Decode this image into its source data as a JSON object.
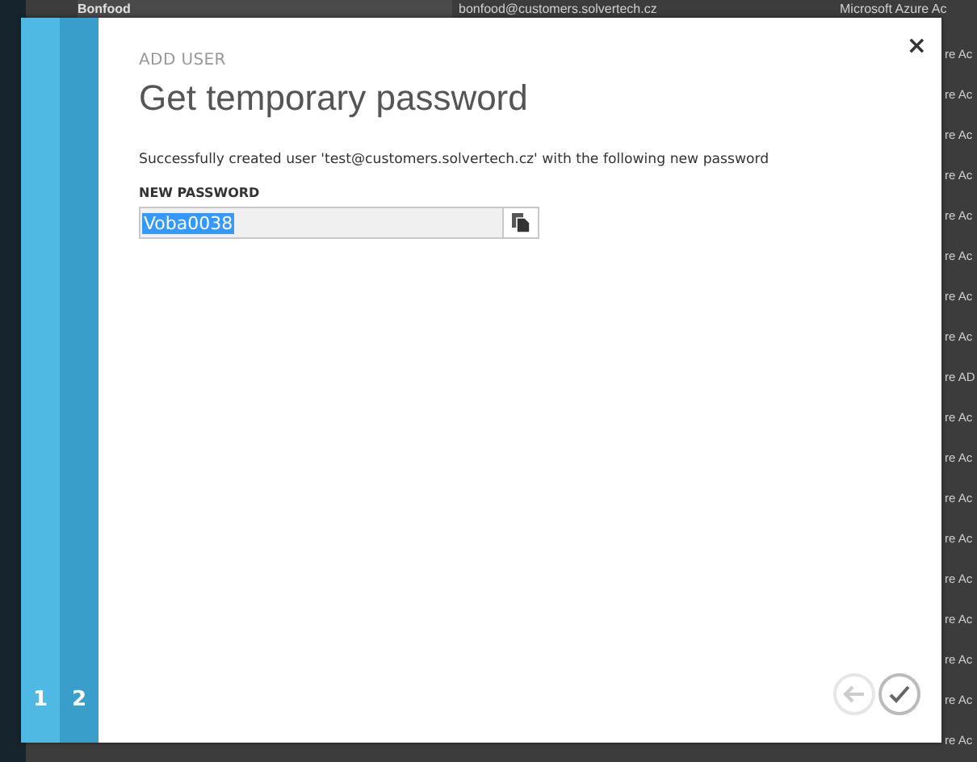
{
  "background_table": {
    "first_row": {
      "name": "Bonfood",
      "email": "bonfood@customers.solvertech.cz",
      "column_3": "Microsoft Azure Ac"
    },
    "column_3_partial": [
      "re Ac",
      "re Ac",
      "re Ac",
      "re Ac",
      "re Ac",
      "re Ac",
      "re Ac",
      "re Ac",
      "re AD",
      "re Ac",
      "re Ac",
      "re Ac",
      "re Ac",
      "re Ac",
      "re Ac",
      "re Ac",
      "re Ac",
      "re Ac"
    ]
  },
  "wizard": {
    "steps": [
      {
        "label": "1",
        "selected": false
      },
      {
        "label": "2",
        "selected": true
      }
    ],
    "eyebrow": "ADD USER",
    "title": "Get temporary password",
    "close": "×",
    "message": "Successfully created user 'test@customers.solvertech.cz' with the following new password",
    "password_label": "NEW PASSWORD",
    "password_value": "Voba0038",
    "password_selected": true,
    "back_disabled": true
  }
}
